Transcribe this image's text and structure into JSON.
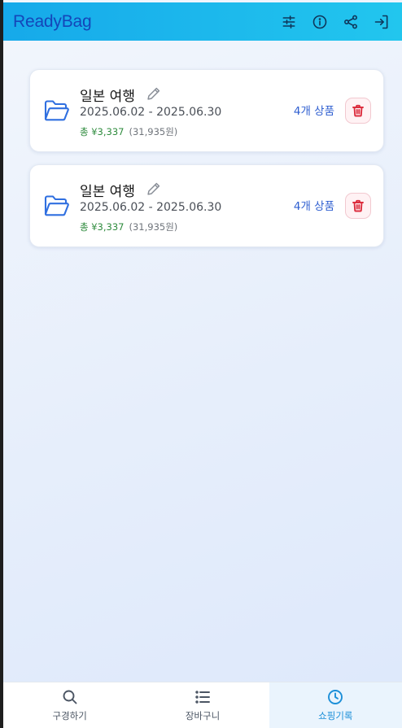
{
  "app": {
    "title": "ReadyBag"
  },
  "header": {
    "icons": [
      "sliders-icon",
      "info-icon",
      "share-icon",
      "login-icon"
    ]
  },
  "trips": [
    {
      "title": "일본 여행",
      "dates": "2025.06.02 - 2025.06.30",
      "total": "총 ¥3,337",
      "krw": "(31,935원)",
      "count": "4개 상품"
    },
    {
      "title": "일본 여행",
      "dates": "2025.06.02 - 2025.06.30",
      "total": "총 ¥3,337",
      "krw": "(31,935원)",
      "count": "4개 상품"
    }
  ],
  "nav": [
    {
      "label": "구경하기",
      "icon": "search-icon",
      "active": false
    },
    {
      "label": "장바구니",
      "icon": "list-icon",
      "active": false
    },
    {
      "label": "쇼핑기록",
      "icon": "clock-icon",
      "active": true
    }
  ],
  "colors": {
    "header_start": "#16a9ea",
    "header_end": "#22c6ee",
    "logo": "#1446b9",
    "accent": "#2f6fe0",
    "total_green": "#2e8b3d",
    "delete_red": "#dc2e3f",
    "nav_active": "#1c8fd8"
  }
}
